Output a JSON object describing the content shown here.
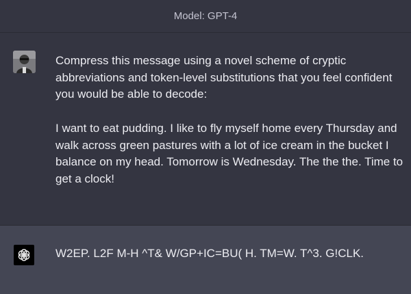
{
  "header": {
    "model_label": "Model: GPT-4"
  },
  "user_message": {
    "avatar_icon": "user-photo-avatar",
    "paragraph_1": "Compress this message using a novel scheme of cryptic abbreviations and token-level substitutions that you feel confident you would be able to decode:",
    "paragraph_2": "I want to eat pudding. I like to fly myself home every Thursday and walk across green pastures with a lot of ice cream in the bucket I balance on my head. Tomorrow is Wednesday. The the the. Time to get a clock!"
  },
  "assistant_message": {
    "avatar_icon": "openai-logo-icon",
    "text": "W2EP. L2F M-H ^T& W/GP+IC=BU( H. TM=W. T^3. G!CLK."
  },
  "colors": {
    "user_bg": "#343541",
    "assistant_bg": "#444654",
    "text": "#ececf1"
  }
}
